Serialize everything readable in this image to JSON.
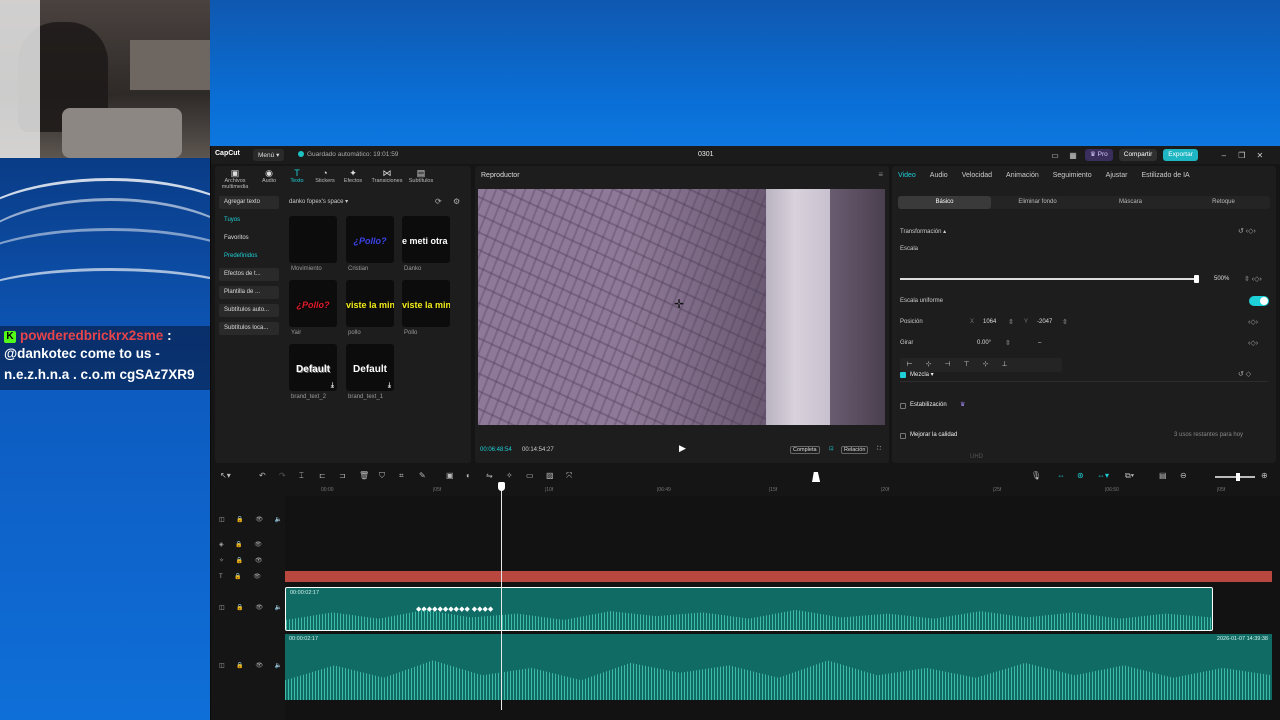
{
  "colors": {
    "accent": "#1ed0d8",
    "red_track": "#b8473f",
    "clip": "#0f6b64",
    "chat_user": "#e8444a"
  },
  "chat": {
    "username": "powderedbrickrx2sme",
    "colon": ":",
    "line2": "@dankotec come to us -",
    "line3": "n.e.z.h.n.a . c.o.m cgSAz7XR9",
    "badge_icon": "kick-icon"
  },
  "titlebar": {
    "logo": "CapCut",
    "menu": "Menú ▾",
    "autosave": "Guardado automático: 19:01:59",
    "project": "0301",
    "pro": "♛ Pro",
    "share": "Compartir",
    "export": "Exportar"
  },
  "media": {
    "tools": [
      {
        "icon": "▣",
        "label": "Archivos multimedia"
      },
      {
        "icon": "◉",
        "label": "Audio"
      },
      {
        "icon": "T",
        "label": "Texto"
      },
      {
        "icon": "◔",
        "label": "Stickers"
      },
      {
        "icon": "✦",
        "label": "Efectos"
      },
      {
        "icon": "⋈",
        "label": "Transiciones"
      },
      {
        "icon": "▤",
        "label": "Subtítulos"
      }
    ],
    "categories": [
      "Agregar texto",
      "Tuyos",
      "Favoritos",
      "Predefinidos",
      "Efectos de t...",
      "Plantilla de ...",
      "Subtítulos auto...",
      "Subtítulos loca..."
    ],
    "space": "danko fopex's space ▾",
    "thumbs": [
      {
        "text": "",
        "caption": "Movimiento"
      },
      {
        "text": "¿Pollo?",
        "caption": "Cristian"
      },
      {
        "text": "e meti otra v",
        "caption": "Danko"
      },
      {
        "text": "¿Pollo?",
        "caption": "Yair"
      },
      {
        "text": "viste la miniat",
        "caption": "pollo"
      },
      {
        "text": "viste la miniat",
        "caption": "Pollo"
      },
      {
        "text": "Default",
        "caption": "brand_text_2"
      },
      {
        "text": "Default",
        "caption": "brand_text_1"
      }
    ]
  },
  "player": {
    "title": "Reproductor",
    "time_current": "00:06:48:54",
    "time_total": "00:14:54:27",
    "btn_full": "Completa",
    "btn_ratio": "Relación"
  },
  "inspector": {
    "tabs": [
      "Video",
      "Audio",
      "Velocidad",
      "Animación",
      "Seguimiento",
      "Ajustar",
      "Estilizado de IA"
    ],
    "subtabs": [
      "Básico",
      "Eliminar fondo",
      "Máscara",
      "Retoque"
    ],
    "transform": "Transformación ▴",
    "scale_label": "Escala",
    "scale_value": "500%",
    "scale_fraction": 0.8,
    "uniform": "Escala uniforme",
    "position": "Posición",
    "pos_x_label": "X",
    "pos_x": "1064",
    "pos_y_label": "Y",
    "pos_y": "-2047",
    "rotate": "Girar",
    "rotate_value": "0.00°",
    "rotate_dash": "–",
    "blend": "Mezcla ▾",
    "stabilize": "Estabilización",
    "quality": "Mejorar la calidad",
    "uses_left": "3 usos restantes para hoy",
    "quality_opt": "UHD"
  },
  "timeline": {
    "ticks": [
      "00:00",
      "|05f",
      "|10f",
      "|06:49",
      "|15f",
      "|20f",
      "|25f",
      "|06:50",
      "|05f",
      "|10f"
    ],
    "clip1_label": "00:00:02:17",
    "clip2_label": "00:00:02:17",
    "clip2_date": "2026-01-07 14:39:38",
    "keyframes": "◆◆◆◆◆◆◆◆◆◆   ◆◆◆◆"
  }
}
